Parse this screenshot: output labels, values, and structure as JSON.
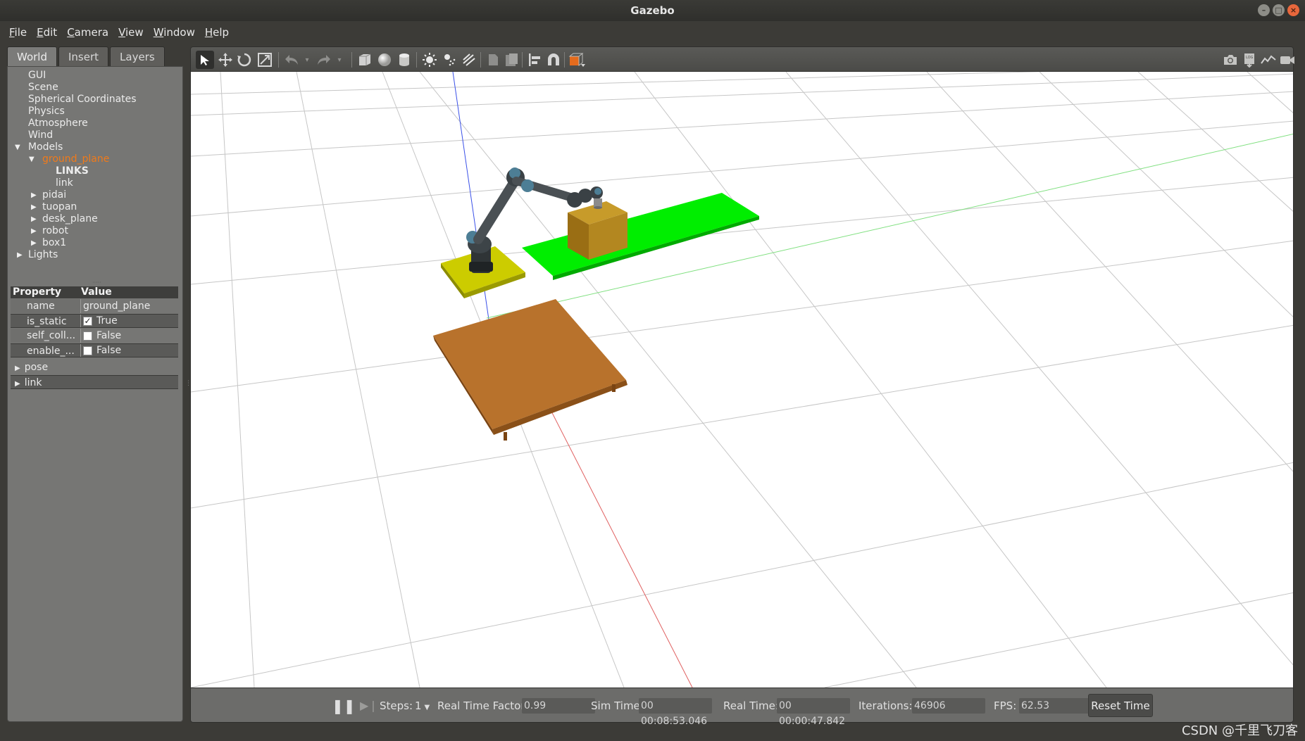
{
  "window": {
    "title": "Gazebo",
    "buttons": [
      "–",
      "□",
      "×"
    ]
  },
  "menu": [
    {
      "first": "F",
      "rest": "ile"
    },
    {
      "first": "E",
      "rest": "dit"
    },
    {
      "first": "C",
      "rest": "amera"
    },
    {
      "first": "V",
      "rest": "iew"
    },
    {
      "first": "W",
      "rest": "indow"
    },
    {
      "first": "H",
      "rest": "elp"
    }
  ],
  "tabs": [
    "World",
    "Insert",
    "Layers"
  ],
  "tree": {
    "gui": "GUI",
    "scene": "Scene",
    "spherical": "Spherical Coordinates",
    "physics": "Physics",
    "atmosphere": "Atmosphere",
    "wind": "Wind",
    "models": "Models",
    "ground_plane": "ground_plane",
    "links_header": "LINKS",
    "link": "link",
    "pidai": "pidai",
    "tuopan": "tuopan",
    "desk_plane": "desk_plane",
    "robot": "robot",
    "box1": "box1",
    "lights": "Lights"
  },
  "properties": {
    "header_property": "Property",
    "header_value": "Value",
    "rows": [
      {
        "name": "name",
        "value": "ground_plane",
        "checkbox": false
      },
      {
        "name": "is_static",
        "value": "True",
        "checkbox": true,
        "checked": true
      },
      {
        "name": "self_coll...",
        "value": "False",
        "checkbox": true,
        "checked": false
      },
      {
        "name": "enable_...",
        "value": "False",
        "checkbox": true,
        "checked": false
      }
    ],
    "groups": [
      "pose",
      "link"
    ]
  },
  "toolbar_icons": [
    "select-arrow-icon",
    "translate-icon",
    "rotate-icon",
    "scale-icon",
    "undo-icon",
    "redo-icon",
    "box-icon",
    "sphere-icon",
    "cylinder-icon",
    "point-light-icon",
    "spot-light-icon",
    "directional-light-icon",
    "copy-icon",
    "paste-icon",
    "align-icon",
    "snap-icon",
    "view-angle-icon",
    "screenshot-icon",
    "log-icon",
    "plot-icon",
    "video-icon"
  ],
  "status": {
    "steps_label": "Steps:",
    "steps_value": "1",
    "rtf_label": "Real Time Factor:",
    "rtf_value": "0.99",
    "sim_label": "Sim Time:",
    "sim_value": "00 00:08:53.046",
    "real_label": "Real Time:",
    "real_value": "00 00:00:47.842",
    "iter_label": "Iterations:",
    "iter_value": "46906",
    "fps_label": "FPS:",
    "fps_value": "62.53",
    "reset_label": "Reset Time"
  },
  "watermark": "CSDN @千里飞刀客",
  "colors": {
    "selected_tree": "#f07a1a",
    "green_conveyor": "#00ee00",
    "yellow_pad": "#cccc00",
    "brown_box": "#b98a1e",
    "orange_table": "#b8722c",
    "robot_arm": "#3d4448"
  }
}
